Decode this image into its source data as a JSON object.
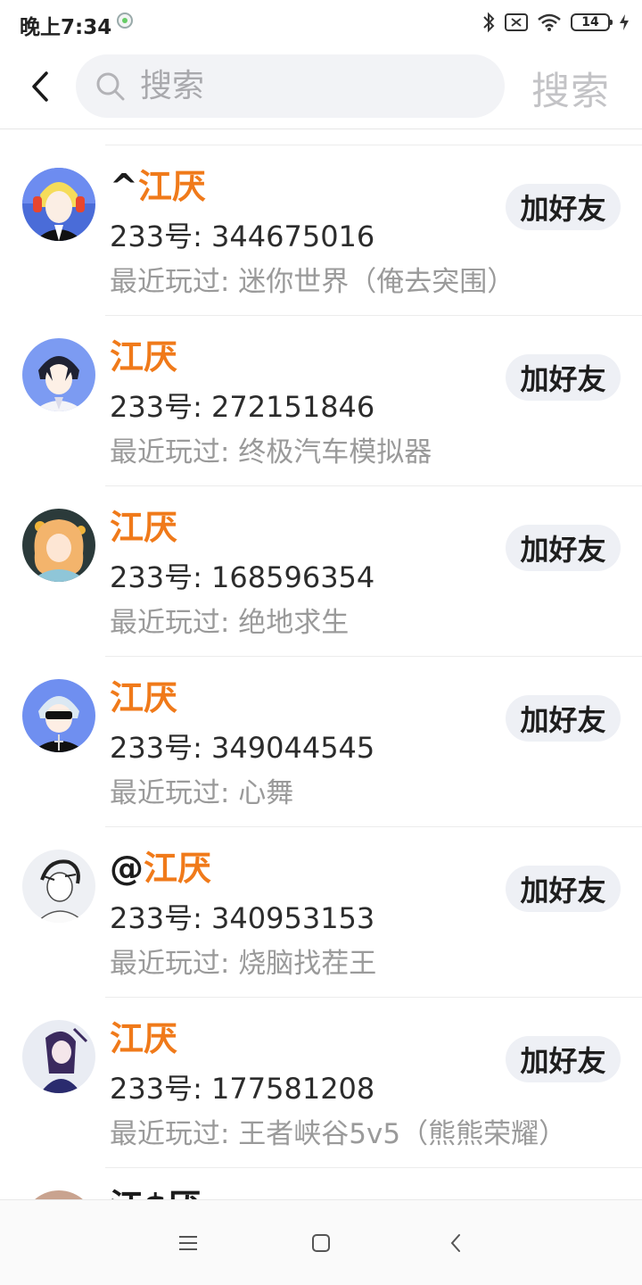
{
  "status_bar": {
    "time": "晚上7:34",
    "battery": "14"
  },
  "search": {
    "placeholder": "搜索",
    "value": "",
    "submit_label": "搜索"
  },
  "results": [
    {
      "prefix": "^",
      "name": "江厌",
      "uid": "233号: 344675016",
      "recent": "最近玩过: 迷你世界（俺去突围）",
      "button": "加好友"
    },
    {
      "prefix": "",
      "name": "江厌",
      "uid": "233号: 272151846",
      "recent": "最近玩过: 终极汽车模拟器",
      "button": "加好友"
    },
    {
      "prefix": "",
      "name": "江厌",
      "uid": "233号: 168596354",
      "recent": "最近玩过: 绝地求生",
      "button": "加好友"
    },
    {
      "prefix": "",
      "name": "江厌",
      "uid": "233号: 349044545",
      "recent": "最近玩过: 心舞",
      "button": "加好友"
    },
    {
      "prefix": "@",
      "name": "江厌",
      "uid": "233号: 340953153",
      "recent": "最近玩过: 烧脑找茬王",
      "button": "加好友"
    },
    {
      "prefix": "",
      "name": "江厌",
      "uid": "233号: 177581208",
      "recent": "最近玩过: 王者峡谷5v5（熊熊荣耀）",
      "button": "加好友"
    }
  ],
  "partial_result": {
    "name": "江$厌"
  },
  "colors": {
    "name_highlight": "#f07a1a",
    "button_bg": "#eef0f5",
    "search_bg": "#f2f3f6",
    "muted_text": "#9a9a9a"
  },
  "icons": {
    "back": "chevron-left-icon",
    "search": "search-icon",
    "nav_menu": "menu-icon",
    "nav_home": "square-home-icon",
    "nav_back": "chevron-left-icon"
  }
}
